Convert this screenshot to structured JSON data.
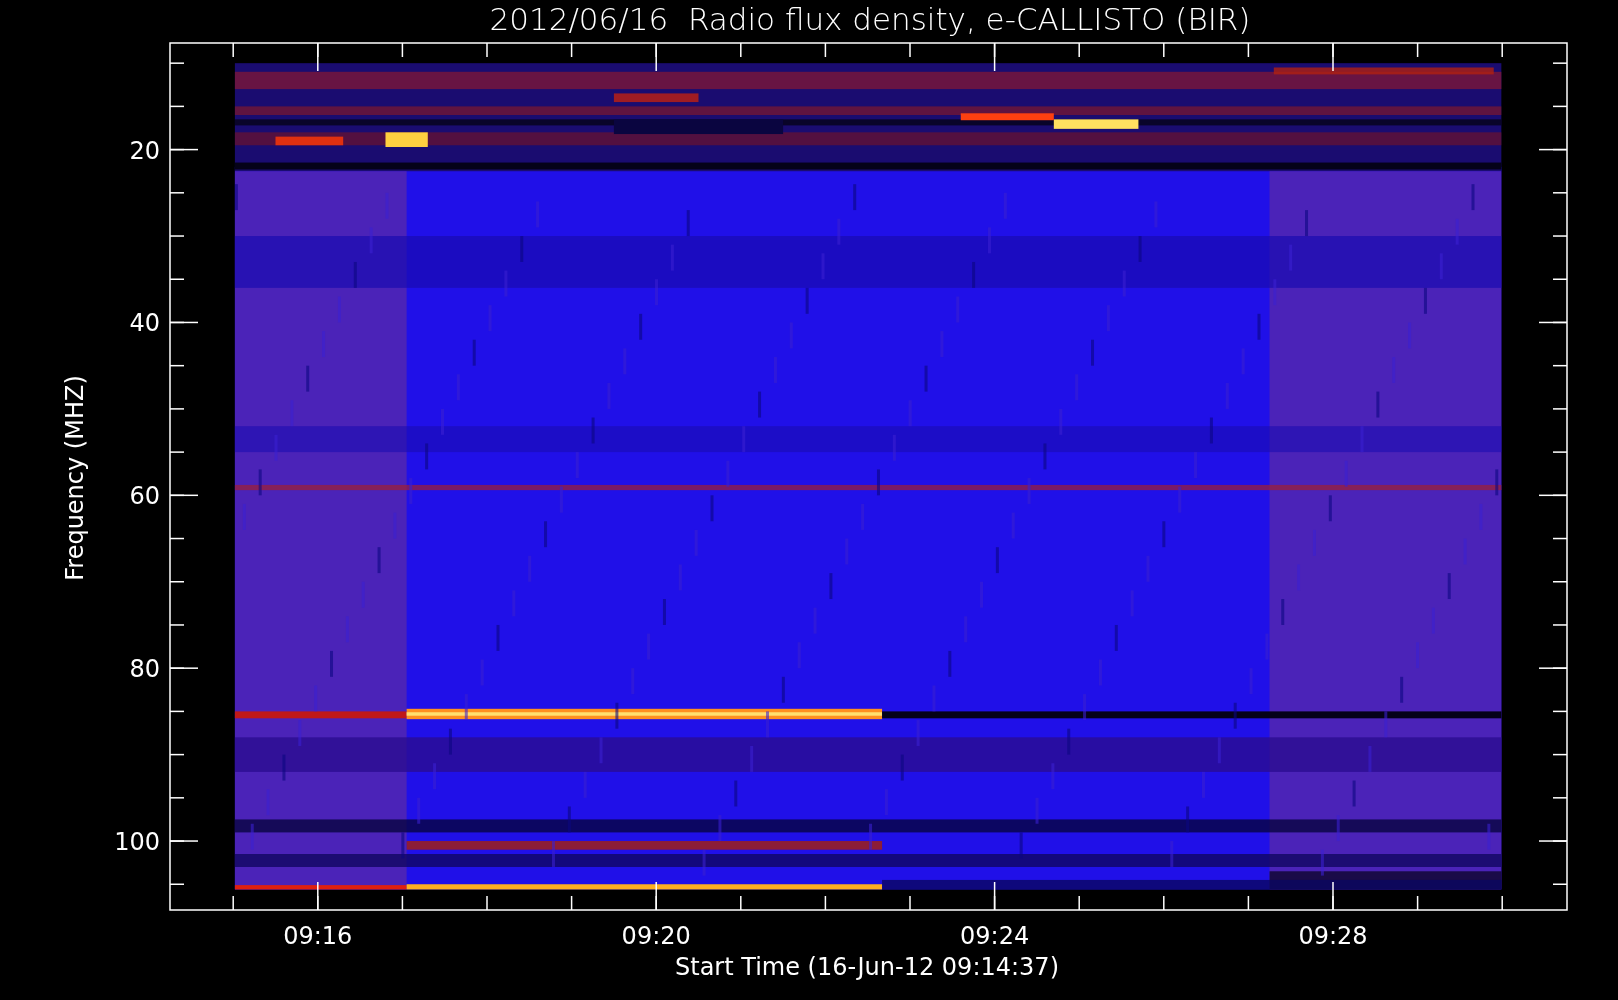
{
  "chart": {
    "title": "2012/06/16  Radio flux density, e-CALLISTO (BIR)",
    "ylabel": "Frequency (MHZ)",
    "xlabel": "Start Time (16-Jun-12 09:14:37)",
    "ytick_labels": [
      "20",
      "40",
      "60",
      "80",
      "100"
    ],
    "xtick_labels": [
      "09:16",
      "09:20",
      "09:24",
      "09:28"
    ]
  }
}
